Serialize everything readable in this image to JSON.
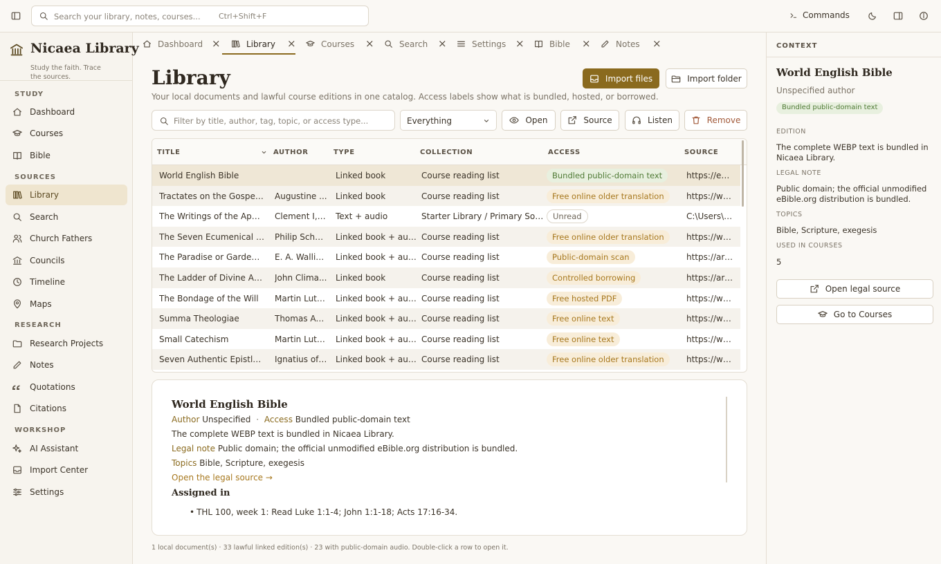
{
  "topbar": {
    "search_placeholder": "Search your library, notes, courses...",
    "search_shortcut": "Ctrl+Shift+F",
    "commands_label": "Commands"
  },
  "brand": {
    "title": "Nicaea Library",
    "subtitle": "Study the faith. Trace the sources."
  },
  "sidebar": {
    "sections": [
      {
        "label": "STUDY",
        "items": [
          {
            "label": "Dashboard",
            "icon": "home-icon"
          },
          {
            "label": "Courses",
            "icon": "graduation-cap-icon"
          },
          {
            "label": "Bible",
            "icon": "book-open-icon"
          }
        ]
      },
      {
        "label": "SOURCES",
        "items": [
          {
            "label": "Library",
            "icon": "library-icon",
            "active": true
          },
          {
            "label": "Search",
            "icon": "search-icon"
          },
          {
            "label": "Church Fathers",
            "icon": "users-icon"
          },
          {
            "label": "Councils",
            "icon": "landmark-icon"
          },
          {
            "label": "Timeline",
            "icon": "clock-icon"
          },
          {
            "label": "Maps",
            "icon": "map-pin-icon"
          }
        ]
      },
      {
        "label": "RESEARCH",
        "items": [
          {
            "label": "Research Projects",
            "icon": "folder-icon"
          },
          {
            "label": "Notes",
            "icon": "pencil-icon"
          },
          {
            "label": "Quotations",
            "icon": "quote-icon"
          },
          {
            "label": "Citations",
            "icon": "file-icon"
          }
        ]
      },
      {
        "label": "WORKSHOP",
        "items": [
          {
            "label": "AI Assistant",
            "icon": "sparkle-icon"
          },
          {
            "label": "Import Center",
            "icon": "inbox-icon"
          },
          {
            "label": "Settings",
            "icon": "sliders-icon"
          }
        ]
      }
    ]
  },
  "tabs": [
    {
      "label": "Dashboard",
      "icon": "home-icon"
    },
    {
      "label": "Library",
      "icon": "library-icon",
      "active": true
    },
    {
      "label": "Courses",
      "icon": "graduation-cap-icon"
    },
    {
      "label": "Search",
      "icon": "search-icon"
    },
    {
      "label": "Settings",
      "icon": "sliders-icon"
    },
    {
      "label": "Bible",
      "icon": "book-open-icon"
    },
    {
      "label": "Notes",
      "icon": "pencil-icon"
    }
  ],
  "main": {
    "title": "Library",
    "subtitle": "Your local documents and lawful course editions in one catalog. Access labels show what is bundled, hosted, or borrowed.",
    "import_files_label": "Import files",
    "import_folder_label": "Import folder",
    "filter_placeholder": "Filter by title, author, tag, topic, or access type...",
    "filter_select_value": "Everything",
    "open_label": "Open",
    "source_label": "Source",
    "listen_label": "Listen",
    "remove_label": "Remove"
  },
  "table": {
    "columns": [
      "TITLE",
      "AUTHOR",
      "TYPE",
      "COLLECTION",
      "ACCESS",
      "SOURCE"
    ],
    "rows": [
      {
        "title": "World English Bible",
        "author": "",
        "type": "Linked book",
        "collection": "Course reading list",
        "access": "Bundled public-domain text",
        "access_tone": "green",
        "source": "https://ebib...",
        "selected": true
      },
      {
        "title": "Tractates on the Gospel of ...",
        "author": "Augustine ...",
        "type": "Linked book",
        "collection": "Course reading list",
        "access": "Free online older translation",
        "access_tone": "orange",
        "source": "https://ww..."
      },
      {
        "title": "The Writings of the Apostol...",
        "author": "Clement I, ...",
        "type": "Text + audio",
        "collection": "Starter Library / Primary Sources",
        "access": "Unread",
        "access_tone": "grey",
        "source": "C:\\Users\\er..."
      },
      {
        "title": "The Seven Ecumenical Cou...",
        "author": "Philip Schaf...",
        "type": "Linked book + audio",
        "collection": "Course reading list",
        "access": "Free online older translation",
        "access_tone": "orange",
        "source": "https://ww..."
      },
      {
        "title": "The Paradise or Garden of ...",
        "author": "E. A. Wallis ...",
        "type": "Linked book + audio",
        "collection": "Course reading list",
        "access": "Public-domain scan",
        "access_tone": "orange",
        "source": "https://arch..."
      },
      {
        "title": "The Ladder of Divine Ascent",
        "author": "John Clima...",
        "type": "Linked book",
        "collection": "Course reading list",
        "access": "Controlled borrowing",
        "access_tone": "orange",
        "source": "https://arch..."
      },
      {
        "title": "The Bondage of the Will",
        "author": "Martin Luther",
        "type": "Linked book + audio",
        "collection": "Course reading list",
        "access": "Free hosted PDF",
        "access_tone": "orange",
        "source": "https://ww..."
      },
      {
        "title": "Summa Theologiae",
        "author": "Thomas Aq...",
        "type": "Linked book + audio",
        "collection": "Course reading list",
        "access": "Free online text",
        "access_tone": "orange",
        "source": "https://ww..."
      },
      {
        "title": "Small Catechism",
        "author": "Martin Luther",
        "type": "Linked book + audio",
        "collection": "Course reading list",
        "access": "Free online text",
        "access_tone": "orange",
        "source": "https://ww..."
      },
      {
        "title": "Seven Authentic Epistles (sh...",
        "author": "Ignatius of ...",
        "type": "Linked book + audio",
        "collection": "Course reading list",
        "access": "Free online older translation",
        "access_tone": "orange",
        "source": "https://ww..."
      }
    ]
  },
  "detail": {
    "title": "World English Bible",
    "author_key": "Author",
    "author_val": "Unspecified",
    "sep": "·",
    "access_key": "Access",
    "access_val": "Bundled public-domain text",
    "description": "The complete WEBP text is bundled in Nicaea Library.",
    "legal_key": "Legal note",
    "legal_val": "Public domain; the official unmodified eBible.org distribution is bundled.",
    "topics_key": "Topics",
    "topics_val": "Bible, Scripture, exegesis",
    "link": "Open the legal source →",
    "assigned_heading": "Assigned in",
    "assigned_items": [
      "THL 100, week 1: Read Luke 1:1-4; John 1:1-18; Acts 17:16-34."
    ]
  },
  "footer": "1 local document(s) · 33 lawful linked edition(s) · 23 with public-domain audio. Double-click a row to open it.",
  "context": {
    "heading": "CONTEXT",
    "title": "World English Bible",
    "author": "Unspecified author",
    "badge": "Bundled public-domain text",
    "edition_label": "EDITION",
    "edition_val": "The complete WEBP text is bundled in Nicaea Library.",
    "legal_label": "LEGAL NOTE",
    "legal_val": "Public domain; the official unmodified eBible.org distribution is bundled.",
    "topics_label": "TOPICS",
    "topics_val": "Bible, Scripture, exegesis",
    "courses_label": "USED IN COURSES",
    "courses_val": "5",
    "open_legal_label": "Open legal source",
    "go_courses_label": "Go to Courses"
  },
  "colors": {
    "accent": "#8a6a1e",
    "active_nav": "#efe5cf",
    "green_badge": "#4f7a35",
    "orange_badge": "#a7781e"
  }
}
